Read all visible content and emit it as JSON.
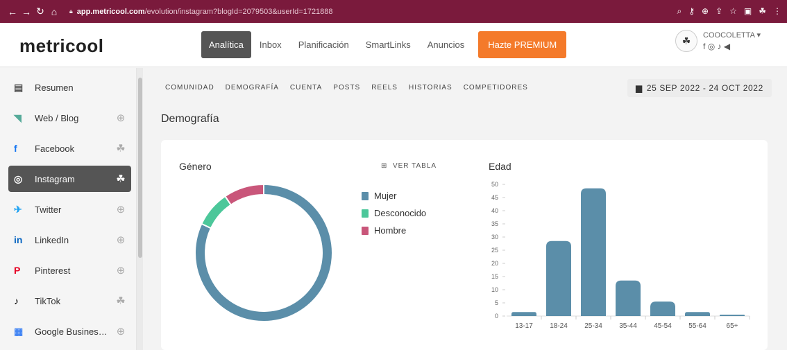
{
  "browser": {
    "url_host": "app.metricool.com",
    "url_path": "/evolution/instagram?blogId=2079503&userId=1721888",
    "toolbar_icons": [
      "search-icon",
      "key-icon",
      "zoom-icon",
      "share-icon",
      "star-icon",
      "sidebar-icon",
      "profile-icon",
      "menu-icon"
    ]
  },
  "header": {
    "logo": "metricool",
    "nav": [
      "Analítica",
      "Inbox",
      "Planificación",
      "SmartLinks",
      "Anuncios"
    ],
    "active": "Analítica",
    "premium": "Hazte PREMIUM",
    "account_name": "COOCOLETTA",
    "account_icons": "f ◎ ♪ ◀"
  },
  "sidebar": {
    "items": [
      {
        "label": "Resumen",
        "icon": "clipboard-icon",
        "glyph": "▤",
        "color": "#555",
        "right": ""
      },
      {
        "label": "Web / Blog",
        "icon": "rss-icon",
        "glyph": "◥",
        "color": "#5a9",
        "right": "⊕"
      },
      {
        "label": "Facebook",
        "icon": "facebook-icon",
        "glyph": "f",
        "color": "#1877f2",
        "right": "☘"
      },
      {
        "label": "Instagram",
        "icon": "instagram-icon",
        "glyph": "◎",
        "color": "#fff",
        "right": "☘"
      },
      {
        "label": "Twitter",
        "icon": "twitter-icon",
        "glyph": "✈",
        "color": "#1da1f2",
        "right": "⊕"
      },
      {
        "label": "LinkedIn",
        "icon": "linkedin-icon",
        "glyph": "in",
        "color": "#0a66c2",
        "right": "⊕"
      },
      {
        "label": "Pinterest",
        "icon": "pinterest-icon",
        "glyph": "P",
        "color": "#e60023",
        "right": "⊕"
      },
      {
        "label": "TikTok",
        "icon": "tiktok-icon",
        "glyph": "♪",
        "color": "#111",
        "right": "☘"
      },
      {
        "label": "Google Busines…",
        "icon": "google-business-icon",
        "glyph": "▦",
        "color": "#4285f4",
        "right": "⊕"
      }
    ]
  },
  "subnav": [
    "COMUNIDAD",
    "DEMOGRAFÍA",
    "CUENTA",
    "POSTS",
    "REELS",
    "HISTORIAS",
    "COMPETIDORES"
  ],
  "date_range": "25 SEP 2022 - 24 OCT 2022",
  "section_title": "Demografía",
  "gender": {
    "title": "Género",
    "ver_tabla": "VER TABLA"
  },
  "age": {
    "title": "Edad"
  },
  "colors": {
    "mujer": "#5b8ea9",
    "desconocido": "#4cc79a",
    "hombre": "#c9567a",
    "bar": "#5b8ea9",
    "brand": "#f47a2a"
  },
  "chart_data": [
    {
      "type": "pie",
      "title": "Género",
      "categories": [
        "Mujer",
        "Desconocido",
        "Hombre"
      ],
      "values": [
        82,
        8.5,
        9.5
      ]
    },
    {
      "type": "bar",
      "title": "Edad",
      "categories": [
        "13-17",
        "18-24",
        "25-34",
        "35-44",
        "45-54",
        "55-64",
        "65+"
      ],
      "values": [
        1.5,
        28.5,
        48.5,
        13.5,
        5.5,
        1.5,
        0.5
      ],
      "yticks": [
        0,
        5,
        10,
        15,
        20,
        25,
        30,
        35,
        40,
        45,
        50
      ],
      "ylim": [
        0,
        50
      ]
    }
  ]
}
